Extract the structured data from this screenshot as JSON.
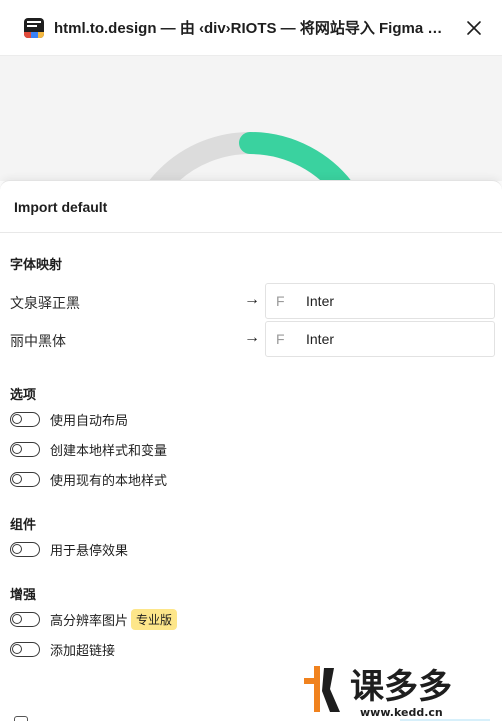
{
  "window": {
    "title": "html.to.design — 由 ‹div›RIOTS — 将网站导入 Figma 设计（...",
    "close_icon": "close-icon"
  },
  "panel": {
    "title": "Import default"
  },
  "font_mapping": {
    "title": "字体映射",
    "rows": [
      {
        "source": "文泉驿正黑",
        "arrow": "→",
        "icon": "F",
        "target": "Inter"
      },
      {
        "source": "丽中黑体",
        "arrow": "→",
        "icon": "F",
        "target": "Inter"
      }
    ]
  },
  "options": {
    "title": "选项",
    "items": [
      {
        "label": "使用自动布局"
      },
      {
        "label": "创建本地样式和变量"
      },
      {
        "label": "使用现有的本地样式"
      }
    ]
  },
  "components": {
    "title": "组件",
    "items": [
      {
        "label": "用于悬停效果"
      }
    ]
  },
  "enhance": {
    "title": "增强",
    "items": [
      {
        "label": "高分辨率图片",
        "badge": "专业版"
      },
      {
        "label": "添加超链接"
      }
    ]
  },
  "watermark": {
    "brand": "课多多",
    "url": "www.kedd.cn"
  },
  "colors": {
    "accent_green": "#3ad29f",
    "pro_badge": "#fde68a",
    "watermark_orange": "#f0821e"
  }
}
